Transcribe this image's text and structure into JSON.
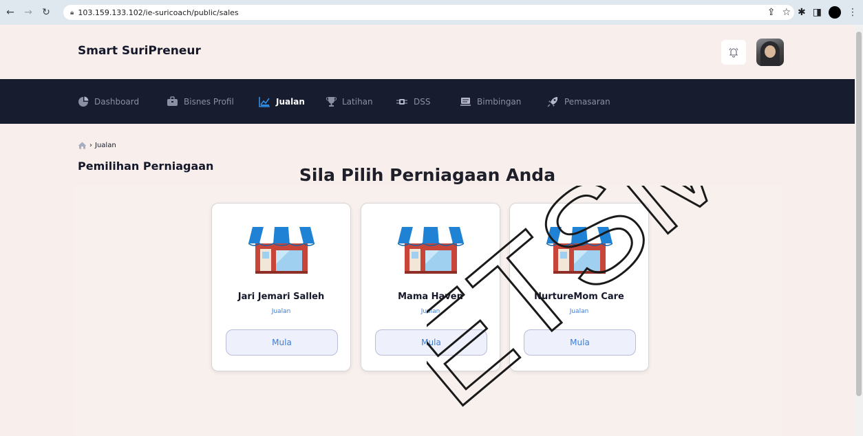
{
  "browser": {
    "url": "103.159.133.102/ie-suricoach/public/sales"
  },
  "header": {
    "brand": "Smart SuriPreneur"
  },
  "nav": {
    "items": [
      {
        "label": "Dashboard",
        "icon": "pie-chart-icon"
      },
      {
        "label": "Bisnes Profil",
        "icon": "briefcase-icon"
      },
      {
        "label": "Jualan",
        "icon": "line-chart-icon",
        "active": true
      },
      {
        "label": "Latihan",
        "icon": "trophy-icon"
      },
      {
        "label": "DSS",
        "icon": "chip-icon"
      },
      {
        "label": "Bimbingan",
        "icon": "presentation-icon"
      },
      {
        "label": "Pemasaran",
        "icon": "rocket-icon"
      }
    ]
  },
  "breadcrumb": {
    "current": "Jualan"
  },
  "page": {
    "title": "Pemilihan Perniagaan",
    "headline": "Sila Pilih Perniagaan Anda"
  },
  "businesses": [
    {
      "name": "Jari Jemari Salleh",
      "category": "Jualan",
      "button": "Mula"
    },
    {
      "name": "Mama Haven",
      "category": "Jualan",
      "button": "Mula"
    },
    {
      "name": "NurtureMom Care",
      "category": "Jualan",
      "button": "Mula"
    }
  ],
  "watermark": "ETSM",
  "colors": {
    "navbar": "#181c2f",
    "page_bg": "#f8efec",
    "accent_blue": "#3d7dd6",
    "awning_blue": "#1f82d4",
    "wall_red": "#c8453a"
  }
}
